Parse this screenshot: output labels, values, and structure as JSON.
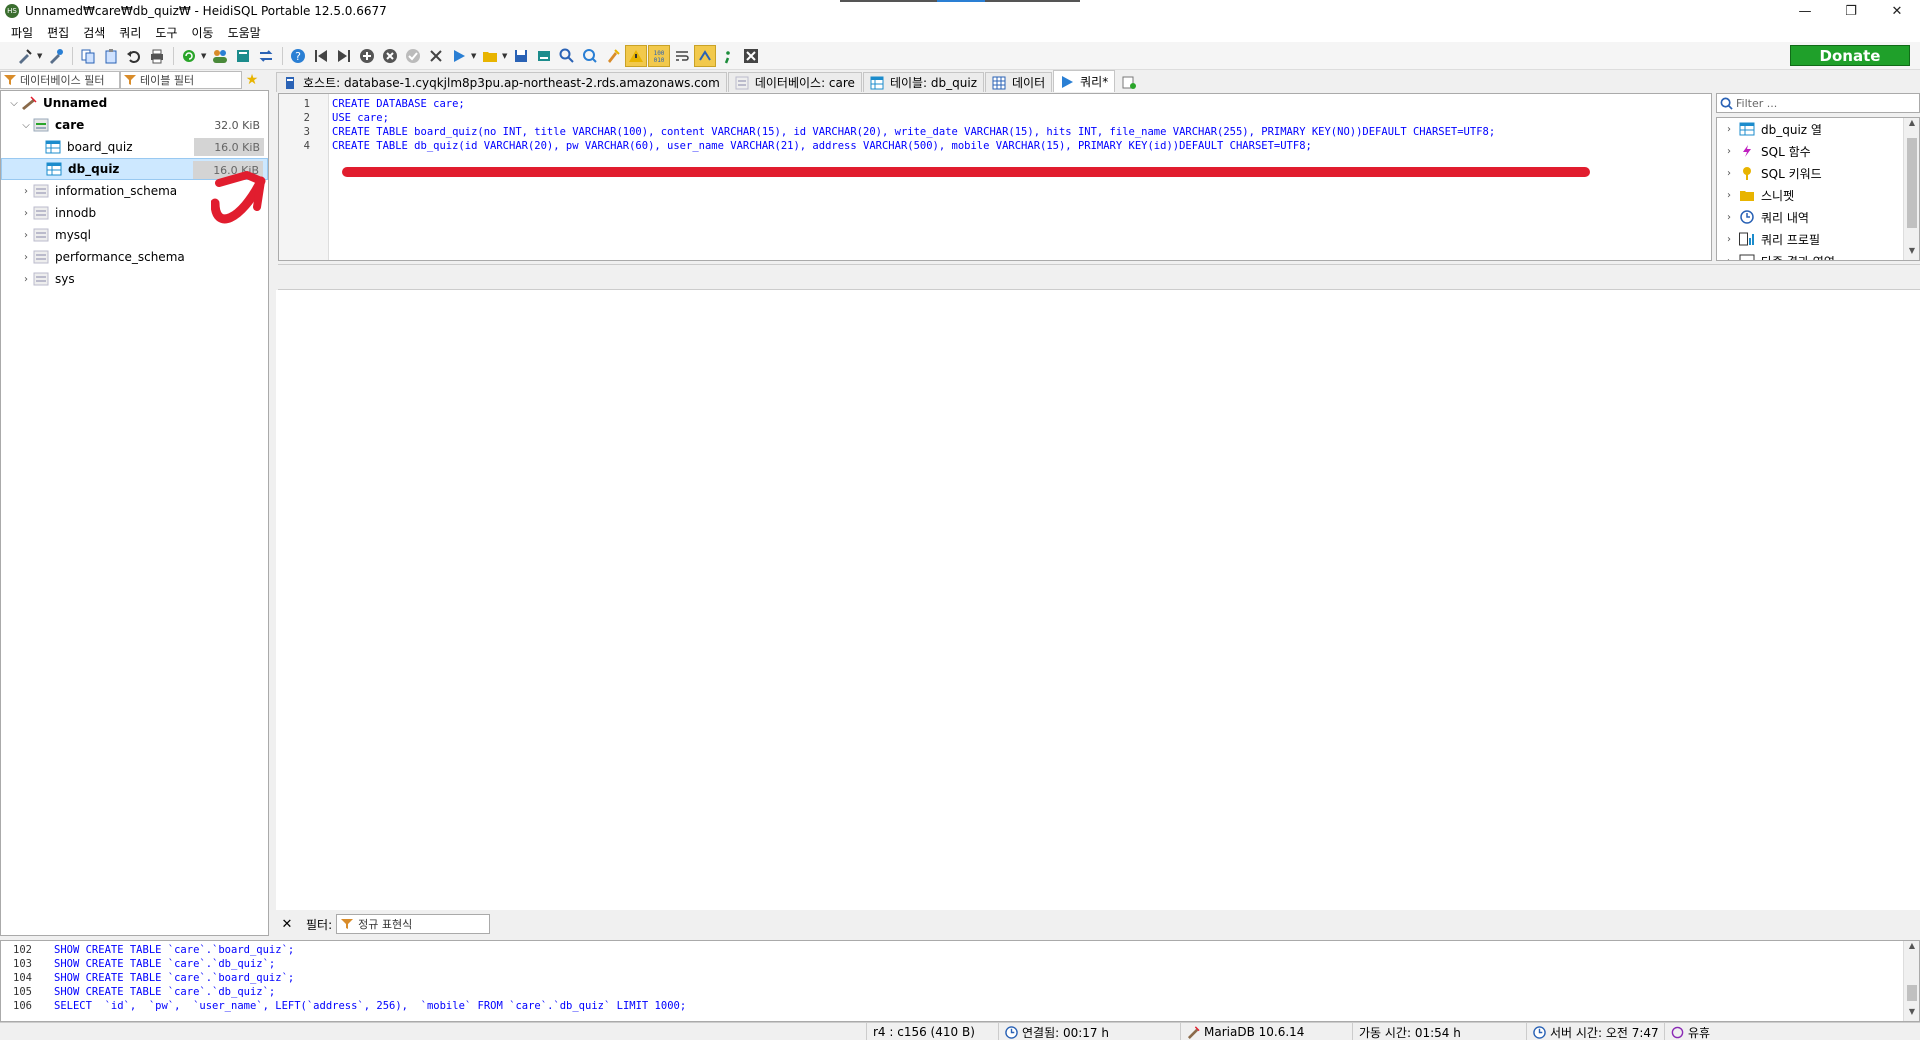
{
  "window": {
    "title": "Unnamed₩care₩db_quiz₩ - HeidiSQL Portable 12.5.0.6677",
    "app_icon_text": "HS",
    "minimize": "—",
    "restore": "❐",
    "close": "✕"
  },
  "menu": [
    "파일",
    "편집",
    "검색",
    "쿼리",
    "도구",
    "이동",
    "도움말"
  ],
  "toolbar": {
    "donate_label": "Donate"
  },
  "left_panel": {
    "db_filter_placeholder": "데이터베이스 필터",
    "table_filter_placeholder": "테이블 필터",
    "tree": [
      {
        "label": "Unnamed",
        "size": "",
        "level": 0,
        "expanded": true,
        "bold": true,
        "icon": "server-icon"
      },
      {
        "label": "care",
        "size": "32.0 KiB",
        "level": 1,
        "expanded": true,
        "bold": true,
        "icon": "database-icon"
      },
      {
        "label": "board_quiz",
        "size": "16.0 KiB",
        "level": 2,
        "icon": "table-icon"
      },
      {
        "label": "db_quiz",
        "size": "16.0 KiB",
        "level": 2,
        "icon": "table-icon",
        "selected": true
      },
      {
        "label": "information_schema",
        "size": "",
        "level": 1,
        "icon": "database-icon"
      },
      {
        "label": "innodb",
        "size": "",
        "level": 1,
        "icon": "database-icon"
      },
      {
        "label": "mysql",
        "size": "",
        "level": 1,
        "icon": "database-icon"
      },
      {
        "label": "performance_schema",
        "size": "",
        "level": 1,
        "icon": "database-icon"
      },
      {
        "label": "sys",
        "size": "",
        "level": 1,
        "icon": "database-icon"
      }
    ]
  },
  "tabs": [
    {
      "label": "호스트: database-1.cyqkjlm8p3pu.ap-northeast-2.rds.amazonaws.com",
      "icon": "host-icon"
    },
    {
      "label": "데이터베이스: care",
      "icon": "database-icon"
    },
    {
      "label": "테이블: db_quiz",
      "icon": "table-icon"
    },
    {
      "label": "데이터",
      "icon": "grid-icon"
    },
    {
      "label": "쿼리*",
      "icon": "play-icon",
      "active": true
    }
  ],
  "editor": {
    "line_numbers": [
      "1",
      "2",
      "3",
      "4"
    ],
    "lines": [
      "CREATE DATABASE care;",
      "USE care;",
      "CREATE TABLE board_quiz(no INT, title VARCHAR(100), content VARCHAR(15), id VARCHAR(20), write_date VARCHAR(15), hits INT, file_name VARCHAR(255), PRIMARY KEY(NO))DEFAULT CHARSET=UTF8;",
      "CREATE TABLE db_quiz(id VARCHAR(20), pw VARCHAR(60), user_name VARCHAR(21), address VARCHAR(500), mobile VARCHAR(15), PRIMARY KEY(id))DEFAULT CHARSET=UTF8;"
    ]
  },
  "helper": {
    "filter_placeholder": "Filter ...",
    "items": [
      {
        "label": "db_quiz 열",
        "icon": "table-icon"
      },
      {
        "label": "SQL 함수",
        "icon": "function-icon"
      },
      {
        "label": "SQL 키워드",
        "icon": "keyword-icon"
      },
      {
        "label": "스니펫",
        "icon": "folder-icon"
      },
      {
        "label": "쿼리 내역",
        "icon": "clock-icon"
      },
      {
        "label": "쿼리 프로필",
        "icon": "profile-icon"
      },
      {
        "label": "다중 결과 영역",
        "icon": "results-icon"
      }
    ]
  },
  "filterbar": {
    "label": "필터:",
    "placeholder": "정규 표현식"
  },
  "log": {
    "line_numbers": [
      "102",
      "103",
      "104",
      "105",
      "106"
    ],
    "lines": [
      "SHOW CREATE TABLE `care`.`board_quiz`;",
      "SHOW CREATE TABLE `care`.`db_quiz`;",
      "SHOW CREATE TABLE `care`.`board_quiz`;",
      "SHOW CREATE TABLE `care`.`db_quiz`;",
      "SELECT  `id`,  `pw`,  `user_name`, LEFT(`address`, 256),  `mobile` FROM `care`.`db_quiz` LIMIT 1000;"
    ]
  },
  "status": {
    "cursor": "r4 : c156 (410 B)",
    "connected": "연결됨: 00:17 h",
    "server": "MariaDB 10.6.14",
    "uptime": "가동 시간: 01:54 h",
    "server_time": "서버 시간: 오전 7:47",
    "idle": "유휴"
  },
  "colors": {
    "annotation": "#e11d2e",
    "donate": "#1fa02a",
    "keyword": "#0000ff"
  }
}
